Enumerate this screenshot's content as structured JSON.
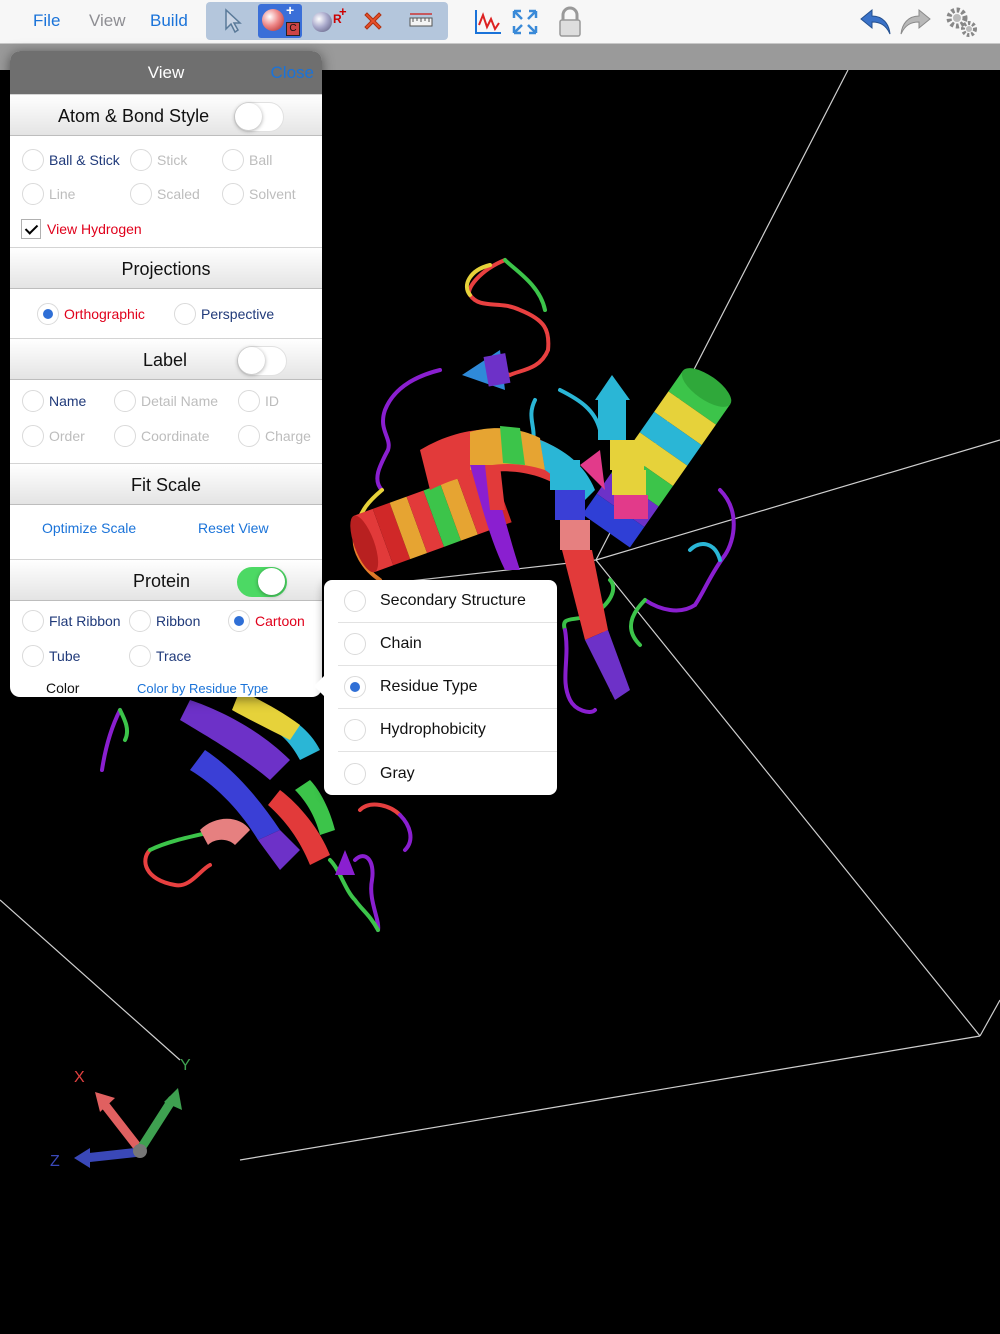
{
  "menu": {
    "file": "File",
    "view": "View",
    "build": "Build"
  },
  "toolbar": {
    "icons": [
      "select-arrow-icon",
      "add-atom-icon",
      "add-group-icon",
      "delete-icon",
      "measure-icon",
      "chart-icon",
      "fit-screen-icon",
      "lock-icon",
      "undo-icon",
      "redo-icon",
      "settings-icon"
    ],
    "add_atom_badge": "C",
    "add_group_badge": "R"
  },
  "panel": {
    "title": "View",
    "close": "Close",
    "atom_bond": {
      "title": "Atom & Bond Style",
      "enabled": false,
      "options": [
        "Ball & Stick",
        "Stick",
        "Ball",
        "Line",
        "Scaled",
        "Solvent"
      ],
      "view_hydrogen": "View Hydrogen"
    },
    "projections": {
      "title": "Projections",
      "options": [
        "Orthographic",
        "Perspective"
      ],
      "selected": "Orthographic"
    },
    "label": {
      "title": "Label",
      "enabled": false,
      "options": [
        "Name",
        "Detail Name",
        "ID",
        "Order",
        "Coordinate",
        "Charge"
      ]
    },
    "fit_scale": {
      "title": "Fit Scale",
      "optimize": "Optimize Scale",
      "reset": "Reset View"
    },
    "protein": {
      "title": "Protein",
      "enabled": true,
      "options": [
        "Flat Ribbon",
        "Ribbon",
        "Cartoon",
        "Tube",
        "Trace"
      ],
      "selected": "Cartoon",
      "color_label": "Color",
      "color_value": "Color by Residue Type"
    }
  },
  "color_popup": {
    "options": [
      "Secondary Structure",
      "Chain",
      "Residue Type",
      "Hydrophobicity",
      "Gray"
    ],
    "selected": "Residue Type"
  },
  "axes": {
    "x": "X",
    "y": "Y",
    "z": "Z"
  },
  "colors": {
    "accent": "#1a73d9",
    "toggle_on": "#4cd964",
    "selected_red": "#e0001b",
    "toolbar_group": "#b4c6dc"
  }
}
